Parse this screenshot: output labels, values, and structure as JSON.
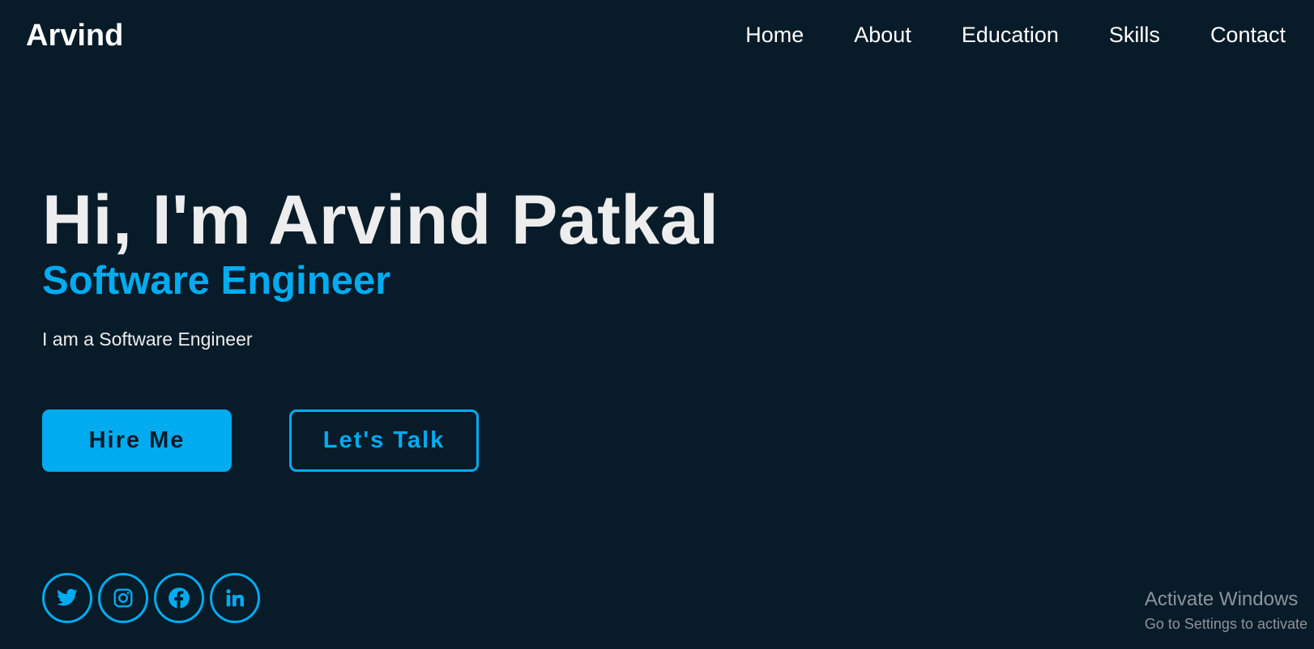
{
  "header": {
    "logo": "Arvind",
    "nav": [
      {
        "label": "Home"
      },
      {
        "label": "About"
      },
      {
        "label": "Education"
      },
      {
        "label": "Skills"
      },
      {
        "label": "Contact"
      }
    ]
  },
  "hero": {
    "title": "Hi, I'm Arvind Patkal",
    "subtitle": "Software Engineer",
    "description": "I am a Software Engineer",
    "buttons": {
      "hire": "Hire Me",
      "talk": "Let's Talk"
    }
  },
  "socials": [
    {
      "icon": "twitter-icon"
    },
    {
      "icon": "instagram-icon"
    },
    {
      "icon": "facebook-icon"
    },
    {
      "icon": "linkedin-icon"
    }
  ],
  "watermark": {
    "title": "Activate Windows",
    "subtitle": "Go to Settings to activate"
  },
  "colors": {
    "background": "#081b29",
    "accent": "#00abf0",
    "text": "#ededed"
  }
}
